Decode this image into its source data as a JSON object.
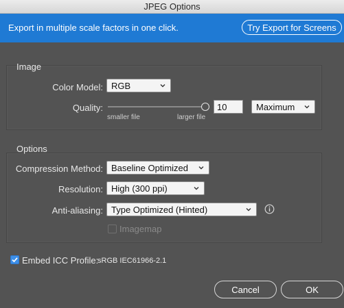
{
  "window": {
    "title": "JPEG Options"
  },
  "banner": {
    "text": "Export in multiple scale factors in one click.",
    "button_label": "Try Export for Screens"
  },
  "image_group": {
    "title": "Image",
    "color_model": {
      "label": "Color Model:",
      "value": "RGB"
    },
    "quality": {
      "label": "Quality:",
      "value": "10",
      "level": 1.0,
      "min_caption": "smaller file",
      "max_caption": "larger file",
      "preset": "Maximum"
    }
  },
  "options_group": {
    "title": "Options",
    "compression": {
      "label": "Compression Method:",
      "value": "Baseline Optimized"
    },
    "resolution": {
      "label": "Resolution:",
      "value": "High (300 ppi)"
    },
    "anti_aliasing": {
      "label": "Anti-aliasing:",
      "value": "Type Optimized (Hinted)",
      "info_icon": "info-icon"
    },
    "imagemap": {
      "label": "Imagemap",
      "checked": false,
      "enabled": false
    }
  },
  "embed_icc": {
    "label": "Embed ICC Profile:",
    "profile": "sRGB IEC61966-2.1",
    "checked": true
  },
  "buttons": {
    "cancel": "Cancel",
    "ok": "OK"
  },
  "colors": {
    "banner": "#1f7ad4",
    "dialog_bg": "#535353",
    "checkbox": "#3d8fe8"
  }
}
